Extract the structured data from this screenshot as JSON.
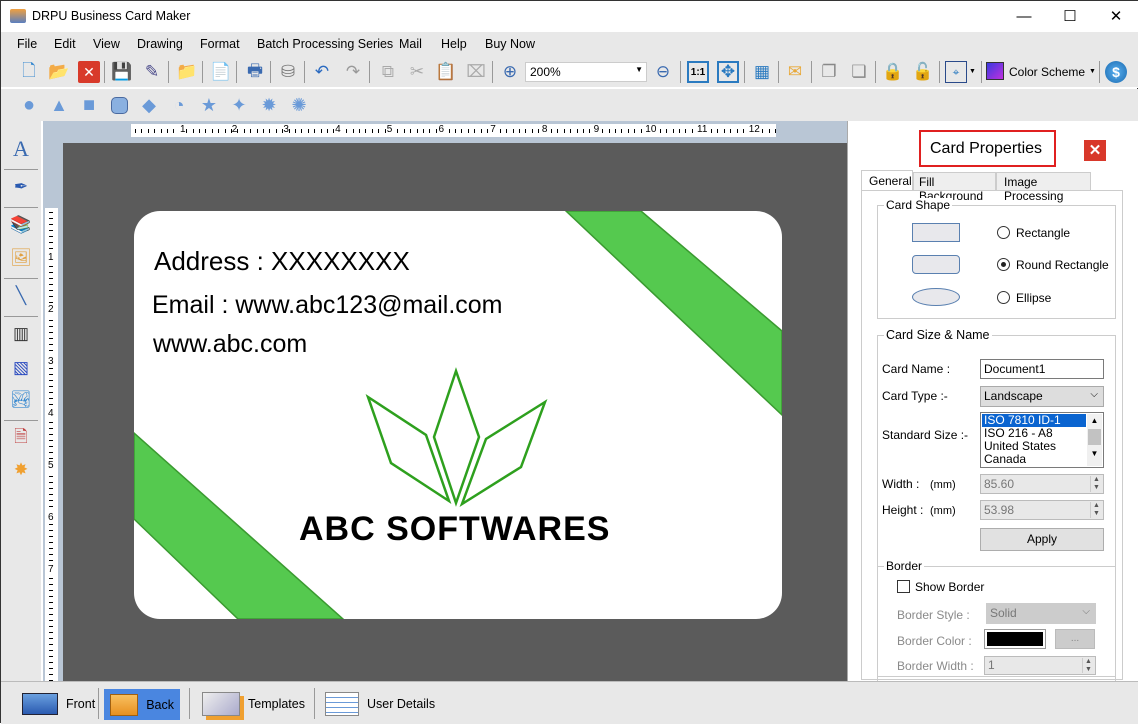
{
  "window": {
    "title": "DRPU Business Card Maker",
    "minimize": "—",
    "maximize": "☐",
    "close": "✕"
  },
  "menu": [
    "File",
    "Edit",
    "View",
    "Drawing",
    "Format",
    "Batch Processing Series",
    "Mail",
    "Help",
    "Buy Now"
  ],
  "toolbar": {
    "zoom_value": "200%",
    "color_scheme_label": "Color Scheme"
  },
  "ruler": {
    "h": [
      "1",
      "2",
      "3",
      "4",
      "5",
      "6",
      "7",
      "8",
      "9",
      "10",
      "11",
      "12"
    ],
    "v": [
      "1",
      "2",
      "3",
      "4",
      "5",
      "6",
      "7"
    ]
  },
  "card": {
    "address": "Address : XXXXXXXX",
    "email": "Email : www.abc123@mail.com",
    "website": "www.abc.com",
    "company": "ABC SOFTWARES",
    "green": "#55c94f",
    "logo_color": "#2ea01e"
  },
  "panel": {
    "title": "Card Properties",
    "tabs": [
      "General",
      "Fill Background",
      "Image Processing"
    ],
    "card_shape": {
      "legend": "Card Shape",
      "options": [
        "Rectangle",
        "Round Rectangle",
        "Ellipse"
      ],
      "selected": "Round Rectangle"
    },
    "size": {
      "legend": "Card Size & Name",
      "card_name_label": "Card Name :",
      "card_name": "Document1",
      "card_type_label": "Card Type :-",
      "card_type": "Landscape",
      "standard_size_label": "Standard Size :-",
      "standard_sizes": [
        "ISO 7810 ID-1",
        "ISO 216 - A8",
        "United States",
        "Canada"
      ],
      "width_label": "Width :",
      "width_unit": "(mm)",
      "width": "85.60",
      "height_label": "Height :",
      "height_unit": "(mm)",
      "height": "53.98",
      "apply": "Apply"
    },
    "border": {
      "legend": "Border",
      "show_border": "Show Border",
      "show_border_checked": false,
      "style_label": "Border Style :",
      "style": "Solid",
      "color_label": "Border Color :",
      "color": "#000000",
      "more": "...",
      "width_label": "Border Width :",
      "width": "1"
    }
  },
  "bottom_tabs": [
    "Front",
    "Back",
    "Templates",
    "User Details"
  ],
  "active_bottom_tab": "Back"
}
